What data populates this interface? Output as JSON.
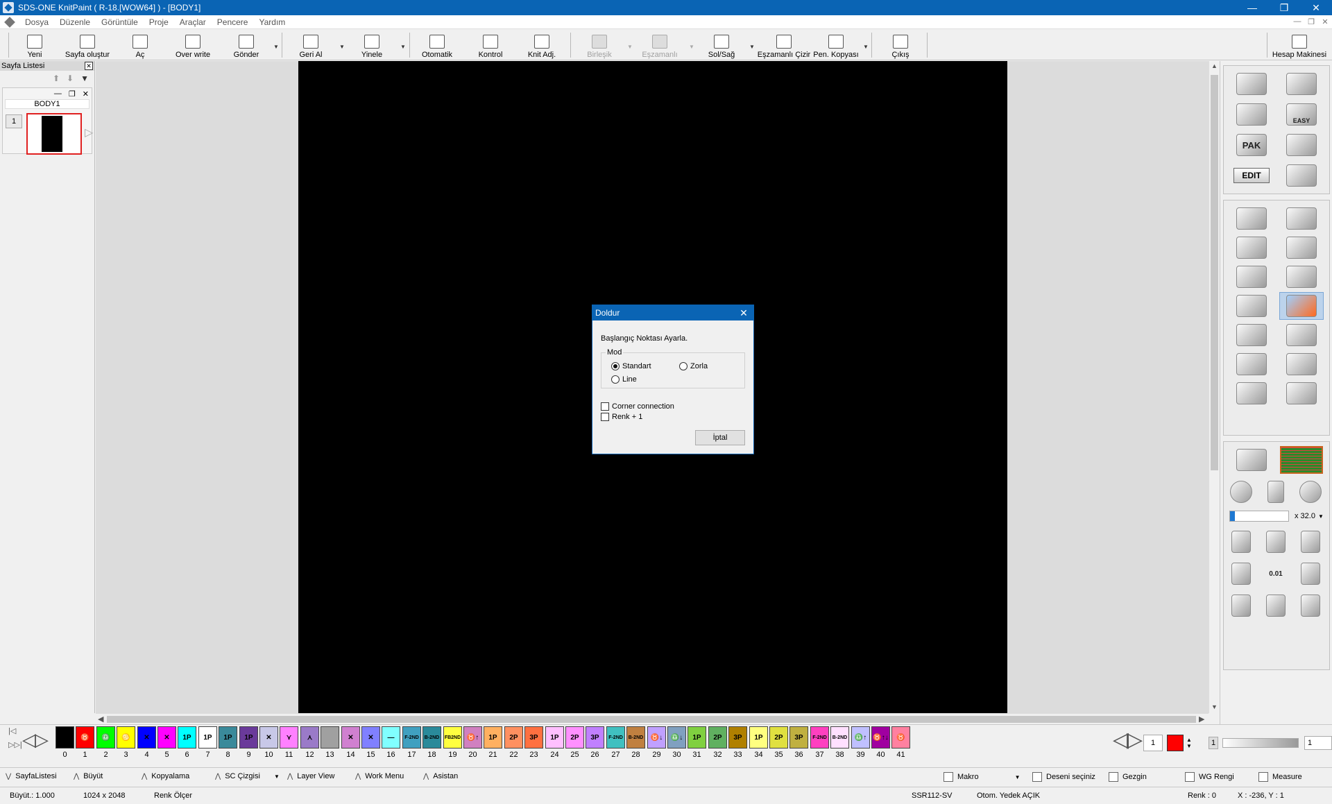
{
  "window": {
    "title": "SDS-ONE KnitPaint ( R-18.[WOW64] ) - [BODY1]",
    "controls": [
      "—",
      "❐",
      "✕"
    ]
  },
  "menu": {
    "items": [
      "Dosya",
      "Düzenle",
      "Görüntüle",
      "Proje",
      "Araçlar",
      "Pencere",
      "Yardım"
    ]
  },
  "toolbar": {
    "buttons": [
      {
        "label": "Yeni",
        "icon": "new-document-icon"
      },
      {
        "label": "Sayfa oluştur",
        "icon": "create-page-icon"
      },
      {
        "label": "Aç",
        "icon": "open-icon"
      },
      {
        "label": "Over write",
        "icon": "overwrite-icon"
      },
      {
        "label": "Gönder",
        "icon": "send-icon"
      },
      {
        "label": "Geri Al",
        "icon": "undo-icon"
      },
      {
        "label": "Yinele",
        "icon": "redo-icon"
      },
      {
        "label": "Otomatik",
        "icon": "printer-icon"
      },
      {
        "label": "Kontrol",
        "icon": "check-icon"
      },
      {
        "label": "Knit Adj.",
        "icon": "knit-adjust-icon"
      },
      {
        "label": "Birleşik",
        "icon": "combine-icon",
        "disabled": true
      },
      {
        "label": "Eşzamanlı",
        "icon": "sync-icon",
        "disabled": true
      },
      {
        "label": "Sol/Sağ",
        "icon": "left-right-icon"
      },
      {
        "label": "Eşzamanlı Çizir",
        "icon": "sync-draw-icon"
      },
      {
        "label": "Pen. Kopyası",
        "icon": "window-copy-icon"
      },
      {
        "label": "Çıkış",
        "icon": "exit-icon"
      },
      {
        "label": "Hesap Makinesi",
        "icon": "calculator-icon"
      }
    ]
  },
  "page_list": {
    "title": "Sayfa Listesi",
    "page_name": "BODY1",
    "page_number": "1"
  },
  "right_panel": {
    "pak_label": "PAK",
    "easy_label": "EASY",
    "edit_label": "EDIT",
    "zoom_label": "x 32.0",
    "zoom_fraction": 0.08,
    "nudge_label": "0.01"
  },
  "palette": {
    "swatches": [
      {
        "n": "0",
        "c": "#000000",
        "t": ""
      },
      {
        "n": "1",
        "c": "#ff0000",
        "t": "♉"
      },
      {
        "n": "2",
        "c": "#00ff00",
        "t": "♎"
      },
      {
        "n": "3",
        "c": "#ffff00",
        "t": "♋"
      },
      {
        "n": "4",
        "c": "#0000ff",
        "t": "✕"
      },
      {
        "n": "5",
        "c": "#ff00ff",
        "t": "✕"
      },
      {
        "n": "6",
        "c": "#00ffff",
        "t": "1P"
      },
      {
        "n": "7",
        "c": "#ffffff",
        "t": "1P"
      },
      {
        "n": "8",
        "c": "#3a8a9a",
        "t": "1P"
      },
      {
        "n": "9",
        "c": "#6a3a9a",
        "t": "1P"
      },
      {
        "n": "10",
        "c": "#c8c8e8",
        "t": "✕"
      },
      {
        "n": "11",
        "c": "#ff80ff",
        "t": "⋎"
      },
      {
        "n": "12",
        "c": "#9a7ac8",
        "t": "⋏"
      },
      {
        "n": "13",
        "c": "#a0a0a0",
        "t": ""
      },
      {
        "n": "14",
        "c": "#d080d0",
        "t": "✕"
      },
      {
        "n": "15",
        "c": "#8080ff",
        "t": "✕"
      },
      {
        "n": "16",
        "c": "#80ffff",
        "t": "—"
      },
      {
        "n": "17",
        "c": "#40a0c0",
        "t": "F-2ND"
      },
      {
        "n": "18",
        "c": "#2a8a9a",
        "t": "B-2ND"
      },
      {
        "n": "19",
        "c": "#ffff40",
        "t": "FB2ND"
      },
      {
        "n": "20",
        "c": "#d080c0",
        "t": "♉↑"
      },
      {
        "n": "21",
        "c": "#ffb060",
        "t": "1P"
      },
      {
        "n": "22",
        "c": "#ff9060",
        "t": "2P"
      },
      {
        "n": "23",
        "c": "#ff7040",
        "t": "3P"
      },
      {
        "n": "24",
        "c": "#ffc0ff",
        "t": "1P"
      },
      {
        "n": "25",
        "c": "#ff90ff",
        "t": "2P"
      },
      {
        "n": "26",
        "c": "#c080ff",
        "t": "3P"
      },
      {
        "n": "27",
        "c": "#40c0c0",
        "t": "F-2ND"
      },
      {
        "n": "28",
        "c": "#c08040",
        "t": "B-2ND"
      },
      {
        "n": "29",
        "c": "#c0a0ff",
        "t": "♉↓"
      },
      {
        "n": "30",
        "c": "#80a0c0",
        "t": "♎↓"
      },
      {
        "n": "31",
        "c": "#80d040",
        "t": "1P"
      },
      {
        "n": "32",
        "c": "#60b060",
        "t": "2P"
      },
      {
        "n": "33",
        "c": "#b08000",
        "t": "3P"
      },
      {
        "n": "34",
        "c": "#ffff80",
        "t": "1P"
      },
      {
        "n": "35",
        "c": "#e0e040",
        "t": "2P"
      },
      {
        "n": "36",
        "c": "#c0b040",
        "t": "3P"
      },
      {
        "n": "37",
        "c": "#ff40c0",
        "t": "F-2ND"
      },
      {
        "n": "38",
        "c": "#ffe0ff",
        "t": "B-2ND"
      },
      {
        "n": "39",
        "c": "#c0c0ff",
        "t": "♎↑"
      },
      {
        "n": "40",
        "c": "#a000a0",
        "t": "♉↑↓"
      },
      {
        "n": "41",
        "c": "#ff80a0",
        "t": "♉"
      }
    ],
    "current_color_index": "1",
    "slider_value": "1",
    "slider_prefix": "1"
  },
  "bottom_bar": {
    "items": [
      "SayfaListesi",
      "Büyüt",
      "Kopyalama",
      "SC Çizgisi",
      "Layer View",
      "Work Menu",
      "Asistan"
    ],
    "right_items": [
      "Makro",
      "Deseni seçiniz",
      "Gezgin",
      "WG Rengi",
      "Measure"
    ]
  },
  "status": {
    "zoom": "Büyüt.: 1.000",
    "size": "1024 x 2048",
    "mode": "Renk Ölçer",
    "machine": "SSR112-SV",
    "backup": "Otom. Yedek AÇIK",
    "color": "Renk :  0",
    "coords": "X : -236, Y :  1"
  },
  "dialog": {
    "title": "Doldur",
    "message": "Başlangıç Noktası Ayarla.",
    "group_label": "Mod",
    "options": {
      "standard": "Standart",
      "force": "Zorla",
      "line": "Line"
    },
    "selected": "standard",
    "corner_connection": "Corner connection",
    "color_plus": "Renk + 1",
    "cancel": "İptal"
  }
}
